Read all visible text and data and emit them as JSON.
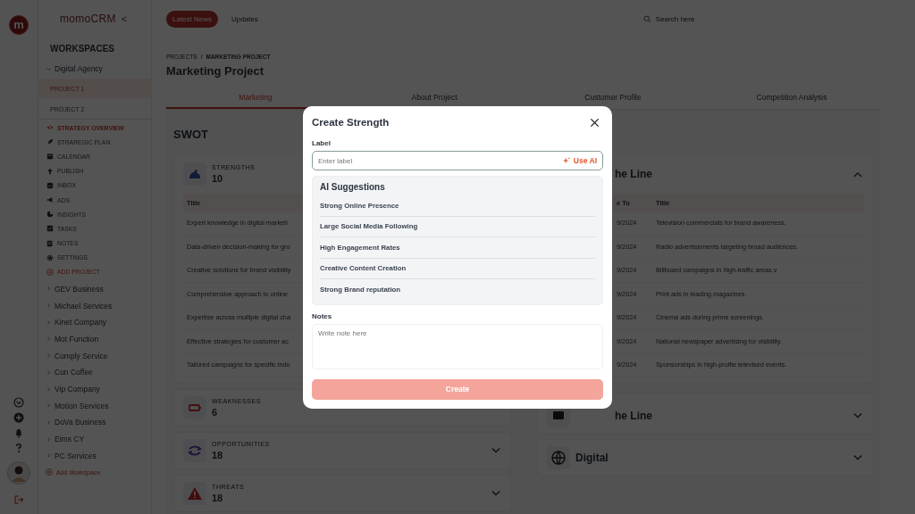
{
  "rail": {
    "logo": "m"
  },
  "sidebar": {
    "brand": "momoCRM",
    "collapse": "<",
    "heading": "WORKSPACES",
    "workspace": {
      "name": "Digital Agency",
      "expanded": true
    },
    "projects": [
      {
        "name": "PROJECT 1",
        "selected": true
      },
      {
        "name": "PROJECT 2",
        "selected": false
      }
    ],
    "menu": [
      {
        "label": "STRATEGY OVERVIEW",
        "selected": true
      },
      {
        "label": "STRAREGIC PLAN",
        "selected": false
      },
      {
        "label": "CALENDAR",
        "selected": false
      },
      {
        "label": "PUBLISH",
        "selected": false
      },
      {
        "label": "INBOX",
        "selected": false
      },
      {
        "label": "ADS",
        "selected": false
      },
      {
        "label": "INSIGHTS",
        "selected": false
      },
      {
        "label": "TASKS",
        "selected": false
      },
      {
        "label": "NOTES",
        "selected": false
      },
      {
        "label": "SETTINGS",
        "selected": false
      }
    ],
    "add_project": "ADD PROJECT",
    "workspaces": [
      {
        "name": "GEV Business",
        "expanded": false
      },
      {
        "name": "Michael Services",
        "expanded": false
      },
      {
        "name": "Kinet Company",
        "expanded": false
      },
      {
        "name": "Mot Function",
        "expanded": false
      },
      {
        "name": "Comply Service",
        "expanded": false
      },
      {
        "name": "Cun Coffee",
        "expanded": false
      },
      {
        "name": "Vip Company",
        "expanded": false
      },
      {
        "name": "Motion Services",
        "expanded": false
      },
      {
        "name": "DoVa Business",
        "expanded": false
      },
      {
        "name": "Eims CY",
        "expanded": false
      },
      {
        "name": "PC Services",
        "expanded": false
      }
    ],
    "add_workspace": "Add Workspace"
  },
  "header": {
    "tabs": [
      {
        "label": "Latest News",
        "selected": true
      },
      {
        "label": "Updates",
        "selected": false
      }
    ],
    "search": {
      "placeholder": "Search here"
    }
  },
  "breadcrumb": [
    "PROJECTS",
    "/",
    "MARKETING PROJECT"
  ],
  "title": "Marketing Project",
  "tabs": [
    {
      "label": "Marketing",
      "selected": true
    },
    {
      "label": "About Project",
      "selected": false
    },
    {
      "label": "Customer Profile",
      "selected": false
    },
    {
      "label": "Competition Analysis",
      "selected": false
    }
  ],
  "swot": {
    "heading": "SWOT",
    "sections": [
      {
        "kind": "strengths",
        "label": "STRENGTHS",
        "count": "10",
        "expanded": true,
        "column": "Title",
        "rows": [
          "Expert knowledge in digital marketi",
          "Data-driven decision-making for gro",
          "Creative solutions for brand visibility",
          "Comprehensive approach to online",
          "Expertise across multiple digital cha",
          "Effective strategies for customer ac",
          "Tailored campaigns for specific indu"
        ]
      },
      {
        "kind": "weaknesses",
        "label": "WEAKNESSES",
        "count": "6",
        "expanded": false
      },
      {
        "kind": "opportunities",
        "label": "OPPORTUNITIES",
        "count": "18",
        "expanded": false
      },
      {
        "kind": "threats",
        "label": "THREATS",
        "count": "18",
        "expanded": false
      }
    ]
  },
  "media": {
    "sections": [
      {
        "kind": "above",
        "title": "he Line",
        "expanded": true,
        "columns": [
          "e To",
          "Title"
        ],
        "rows": [
          [
            "9/2024",
            "Television commercials for brand awareness."
          ],
          [
            "9/2024",
            "Radio advertisements targeting broad audiences."
          ],
          [
            "9/2024",
            "Billboard campaigns in high-traffic areas.v"
          ],
          [
            "9/2024",
            "Print ads in leading magazines."
          ],
          [
            "9/2024",
            "Cinema ads during prime screenings."
          ],
          [
            "9/2024",
            "National newspaper advertising for visibility."
          ],
          [
            "9/2024",
            "Sponsorships in high-profile televised events."
          ]
        ]
      },
      {
        "kind": "below",
        "title": "he Line",
        "expanded": false
      },
      {
        "kind": "digital",
        "title": "Digital",
        "expanded": false
      }
    ]
  },
  "modal": {
    "title": "Create Strength",
    "label": "Label",
    "label_placeholder": "Enter label",
    "use_ai": "Use AI",
    "suggestions_heading": "AI Suggestions",
    "suggestions": [
      "Strong Online Presence",
      "Large Social Media Following",
      "High Engagement Rates",
      "Creative Content Creation",
      "Strong Brand reputation"
    ],
    "notes_label": "Notes",
    "notes_placeholder": "Write note here",
    "submit": "Create",
    "submit_disabled": true
  }
}
